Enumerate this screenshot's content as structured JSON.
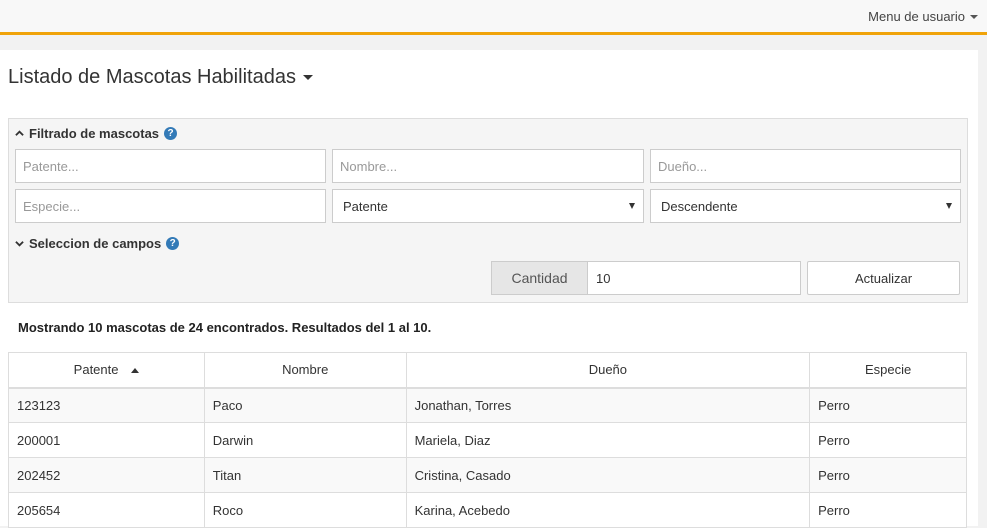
{
  "topbar": {
    "user_menu_label": "Menu de usuario"
  },
  "page": {
    "title": "Listado de Mascotas Habilitadas"
  },
  "filter": {
    "header": "Filtrado de mascotas",
    "patente_placeholder": "Patente...",
    "nombre_placeholder": "Nombre...",
    "dueno_placeholder": "Dueño...",
    "especie_placeholder": "Especie...",
    "order_field_selected": "Patente",
    "order_direction_selected": "Descendente"
  },
  "fields_section": {
    "header": "Seleccion de campos"
  },
  "quantity": {
    "label": "Cantidad",
    "value": "10"
  },
  "update_button": "Actualizar",
  "summary": "Mostrando 10 mascotas de 24 encontrados. Resultados del 1 al 10.",
  "table": {
    "headers": [
      "Patente",
      "Nombre",
      "Dueño",
      "Especie"
    ],
    "sort_column": "Patente",
    "sort_direction": "ascending",
    "rows": [
      [
        "123123",
        "Paco",
        "Jonathan, Torres",
        "Perro"
      ],
      [
        "200001",
        "Darwin",
        "Mariela, Diaz",
        "Perro"
      ],
      [
        "202452",
        "Titan",
        "Cristina, Casado",
        "Perro"
      ],
      [
        "205654",
        "Roco",
        "Karina, Acebedo",
        "Perro"
      ]
    ]
  },
  "colors": {
    "accent": "#f0a30a",
    "help_icon": "#337ab7"
  }
}
